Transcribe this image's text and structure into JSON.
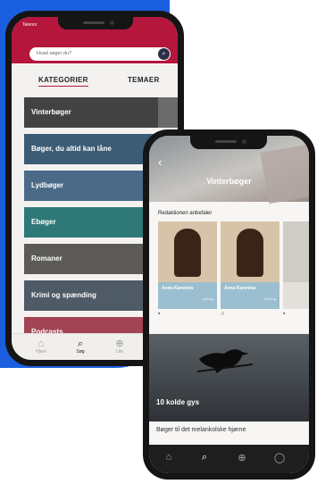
{
  "phone_left": {
    "status_carrier": "Telenor",
    "search": {
      "placeholder": "Hvad søger du?"
    },
    "tabs": [
      {
        "label": "KATEGORIER",
        "active": true
      },
      {
        "label": "TEMAER",
        "active": false
      }
    ],
    "categories": [
      {
        "label": "Vinterbøger",
        "color": "#424242"
      },
      {
        "label": "Bøger, du altid kan låne",
        "color": "#3b5c74"
      },
      {
        "label": "Lydbøger",
        "color": "#4a6a88"
      },
      {
        "label": "Ebøger",
        "color": "#2e7878"
      },
      {
        "label": "Romaner",
        "color": "#5b5a56"
      },
      {
        "label": "Krimi og spænding",
        "color": "#4e5a66"
      },
      {
        "label": "Podcasts",
        "color": "#a24454"
      }
    ],
    "nav": [
      {
        "label": "Hjem",
        "icon": "home-icon",
        "active": false
      },
      {
        "label": "Søg",
        "icon": "search-icon",
        "active": true
      },
      {
        "label": "Lån",
        "icon": "loans-icon",
        "active": false
      }
    ],
    "brand_color": "#b4163c"
  },
  "phone_right": {
    "header_title": "Vinterbøger",
    "section_title": "Redaktionen anbefaler",
    "books": [
      {
        "title": "Anna Karenina",
        "sub": "Lydbog"
      },
      {
        "title": "Anna Karenina",
        "sub": "Lydbog"
      },
      {
        "title": "",
        "sub": ""
      }
    ],
    "type_icons": [
      "book-icon",
      "headphones-icon",
      "book-icon"
    ],
    "feature_title": "10 kolde gys",
    "feature_caption": "Bøger til det melankolske hjørne",
    "nav_icons": [
      "home-icon",
      "search-icon",
      "loans-icon",
      "profile-icon"
    ]
  }
}
